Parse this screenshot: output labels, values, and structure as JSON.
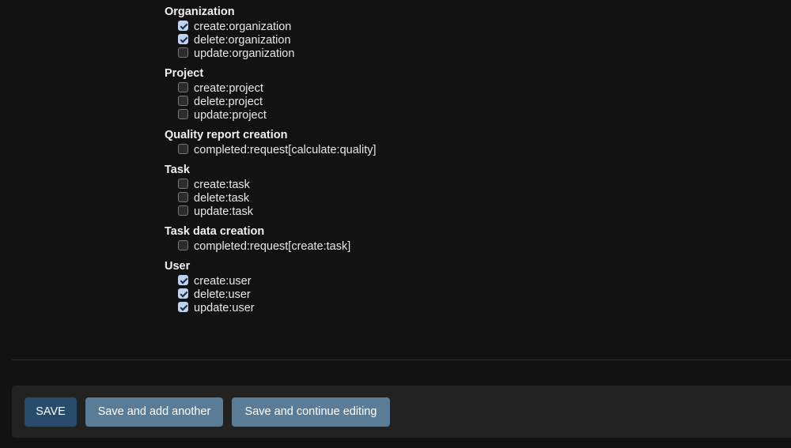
{
  "groups": [
    {
      "title": "Organization",
      "options": [
        {
          "label": "create:organization",
          "checked": true
        },
        {
          "label": "delete:organization",
          "checked": true
        },
        {
          "label": "update:organization",
          "checked": false
        }
      ]
    },
    {
      "title": "Project",
      "options": [
        {
          "label": "create:project",
          "checked": false
        },
        {
          "label": "delete:project",
          "checked": false
        },
        {
          "label": "update:project",
          "checked": false
        }
      ]
    },
    {
      "title": "Quality report creation",
      "options": [
        {
          "label": "completed:request[calculate:quality]",
          "checked": false
        }
      ]
    },
    {
      "title": "Task",
      "options": [
        {
          "label": "create:task",
          "checked": false
        },
        {
          "label": "delete:task",
          "checked": false
        },
        {
          "label": "update:task",
          "checked": false
        }
      ]
    },
    {
      "title": "Task data creation",
      "options": [
        {
          "label": "completed:request[create:task]",
          "checked": false
        }
      ]
    },
    {
      "title": "User",
      "options": [
        {
          "label": "create:user",
          "checked": true
        },
        {
          "label": "delete:user",
          "checked": true
        },
        {
          "label": "update:user",
          "checked": true
        }
      ]
    }
  ],
  "buttons": {
    "save": "SAVE",
    "save_add": "Save and add another",
    "save_continue": "Save and continue editing"
  },
  "colors": {
    "background": "#121212",
    "checkbox_checked": "#bcd2f5",
    "save_button": "#264b6b",
    "secondary_button": "#5b7c96"
  }
}
